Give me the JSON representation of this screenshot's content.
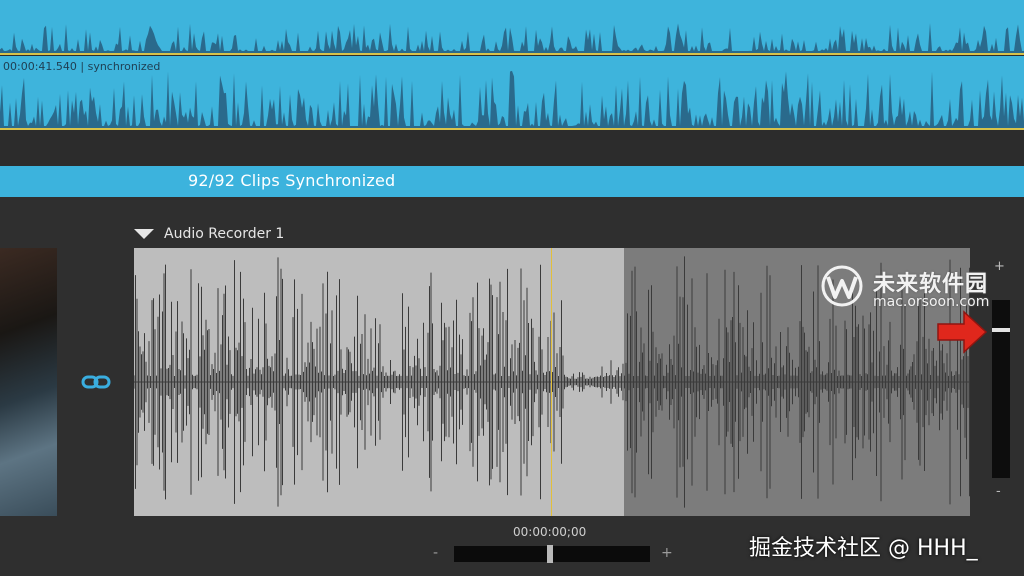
{
  "tracks": {
    "clip_timecode": "00:00:41.540 | synchronized",
    "sync_banner": "92/92 Clips Synchronized"
  },
  "recorder": {
    "name": "Audio Recorder 1"
  },
  "volume": {
    "plus": "+",
    "minus": "-"
  },
  "playback": {
    "timecode": "00:00:00;00",
    "zoom_minus": "-",
    "zoom_plus": "+"
  },
  "watermark": {
    "title": "未来软件园",
    "url": "mac.orsoon.com"
  },
  "credit": "掘金技术社区 @ HHH_",
  "colors": {
    "track_blue": "#3eb4dc",
    "playhead": "#e2bf3a",
    "arrow_red": "#e0271c",
    "link_blue": "#3aaee0"
  }
}
